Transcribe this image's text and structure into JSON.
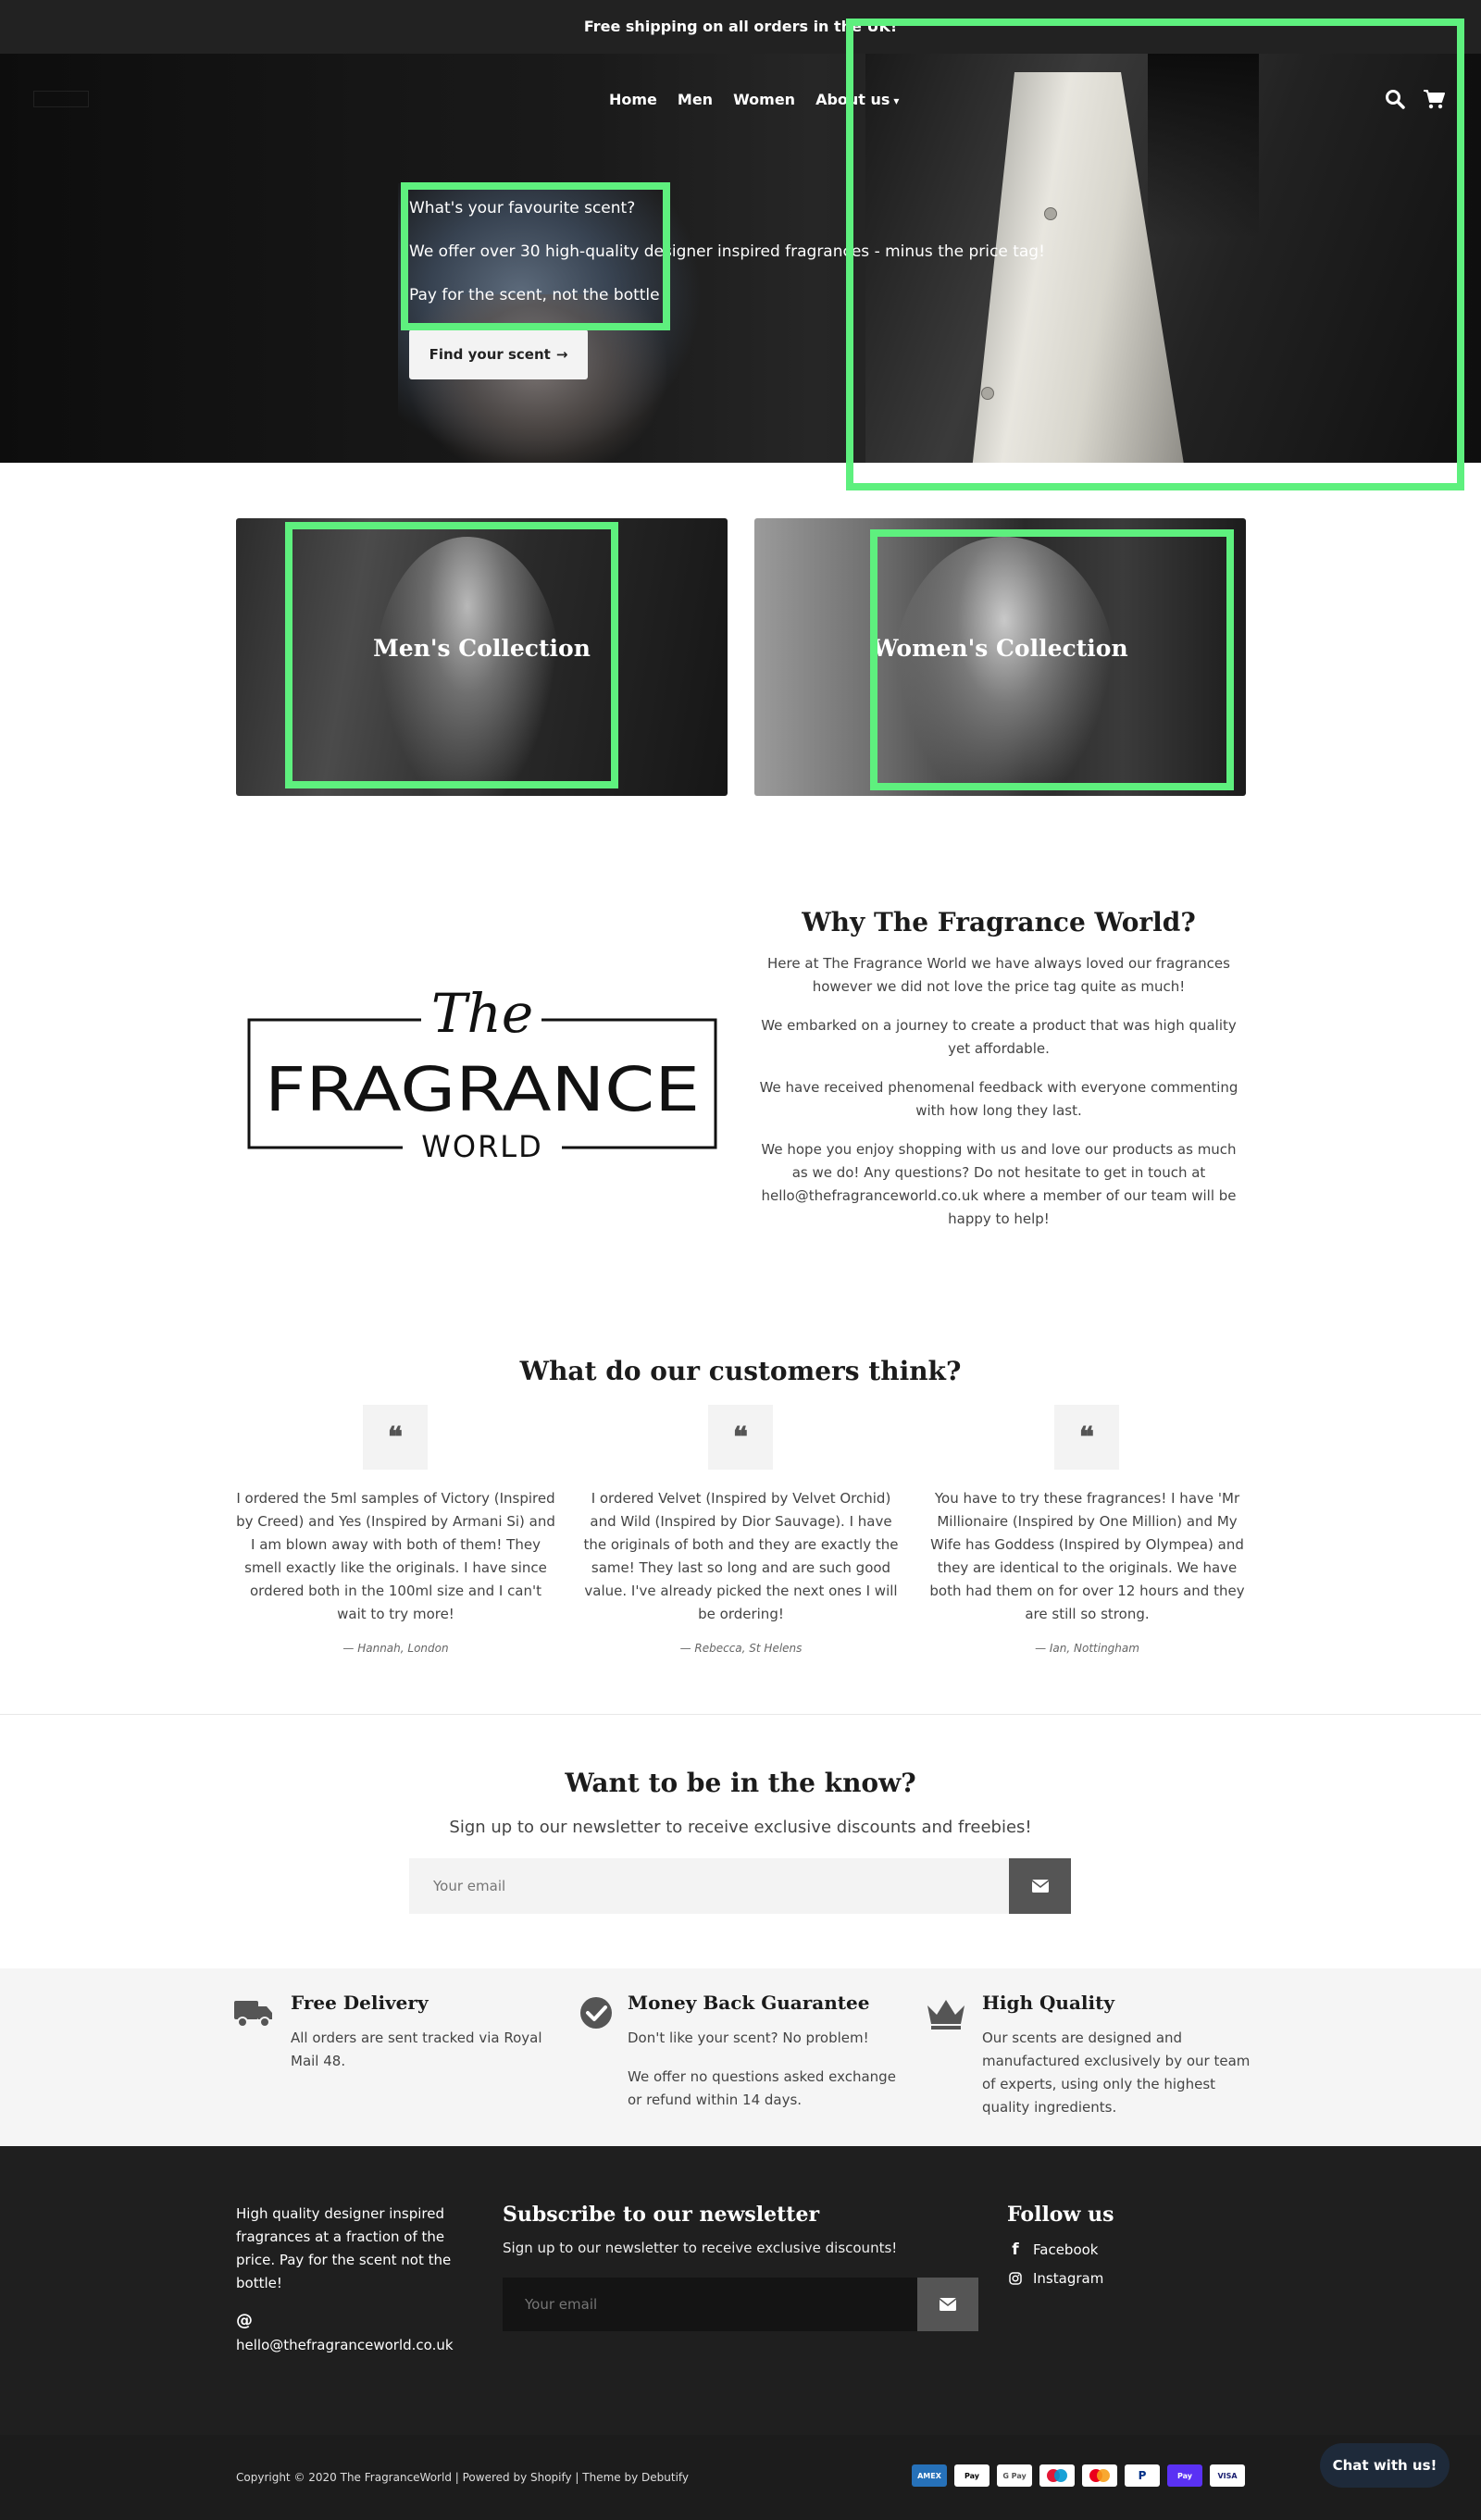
{
  "announcement": "Free shipping on all orders in the UK!",
  "nav": {
    "items": [
      "Home",
      "Men",
      "Women",
      "About us"
    ],
    "search_icon": "search-icon",
    "cart_icon": "cart-icon"
  },
  "hero": {
    "line1": "What's your favourite scent?",
    "line2": "We offer over 30 high-quality designer inspired fragrances - minus the price tag!",
    "line3": "Pay for the scent, not the bottle",
    "cta": "Find your scent"
  },
  "collections": {
    "men": "Men's Collection",
    "women": "Women's Collection"
  },
  "brand_logo": {
    "the": "The",
    "fragrance": "FRAGRANCE",
    "world": "WORLD"
  },
  "why": {
    "title": "Why The Fragrance World?",
    "paragraphs": [
      "Here at The Fragrance World we have always loved our fragrances however we did not love the price tag quite as much!",
      "We embarked on a journey to create a product that was high quality yet affordable.",
      "We have received phenomenal feedback with everyone commenting with how long they last.",
      "We hope you enjoy shopping with us and love our products as much as we do! Any questions? Do not hesitate to get in touch at hello@thefragranceworld.co.uk where a member of our team will be happy to help!"
    ]
  },
  "testimonials": {
    "title": "What do our customers think?",
    "items": [
      {
        "text": "I ordered the 5ml samples of Victory (Inspired by Creed) and Yes (Inspired by Armani Si) and I am blown away with both of them! They smell exactly like the originals. I have since ordered both in the 100ml size and I can't wait to try more!",
        "author": "— Hannah, London"
      },
      {
        "text": "I ordered Velvet (Inspired by Velvet Orchid) and Wild (Inspired by Dior Sauvage). I have the originals of both and they are exactly the same! They last so long and are such good value. I've already picked the next ones I will be ordering!",
        "author": "— Rebecca, St Helens"
      },
      {
        "text": "You have to try these fragrances! I have 'Mr Millionaire (Inspired by One Million) and My Wife has Goddess (Inspired by Olympea) and they are identical to the originals. We have both had them on for over 12 hours and they are still so strong.",
        "author": "— Ian, Nottingham"
      }
    ]
  },
  "newsletter": {
    "title": "Want to be in the know?",
    "subtitle": "Sign up to our newsletter to receive exclusive discounts and freebies!",
    "placeholder": "Your email"
  },
  "features": [
    {
      "icon": "truck-icon",
      "title": "Free Delivery",
      "lines": [
        "All orders are sent tracked via Royal Mail 48."
      ]
    },
    {
      "icon": "check-circle-icon",
      "title": "Money Back Guarantee",
      "lines": [
        "Don't like your scent? No problem!",
        "We offer no questions asked exchange or refund within 14 days."
      ]
    },
    {
      "icon": "crown-icon",
      "title": "High Quality",
      "lines": [
        "Our scents are designed and manufactured exclusively by our team of experts, using only the highest quality ingredients."
      ]
    }
  ],
  "footer": {
    "about": "High quality designer inspired fragrances at a fraction of the price. Pay for the scent not the bottle!",
    "email_symbol": "@",
    "email": "hello@thefragranceworld.co.uk",
    "subscribe_title": "Subscribe to our newsletter",
    "subscribe_text": "Sign up to our newsletter to receive exclusive discounts!",
    "subscribe_placeholder": "Your email",
    "follow_title": "Follow us",
    "social": [
      "Facebook",
      "Instagram"
    ]
  },
  "copyright": "Copyright © 2020 The FragranceWorld | Powered by Shopify | Theme by Debutify",
  "payments": [
    "AMEX",
    "Pay",
    "G Pay",
    "",
    "",
    "P",
    "Pay",
    "VISA"
  ],
  "chat": "Chat with us!",
  "colors": {
    "highlight": "#5ef07e",
    "dark": "#1f1f1f",
    "button_gray": "#555555"
  }
}
